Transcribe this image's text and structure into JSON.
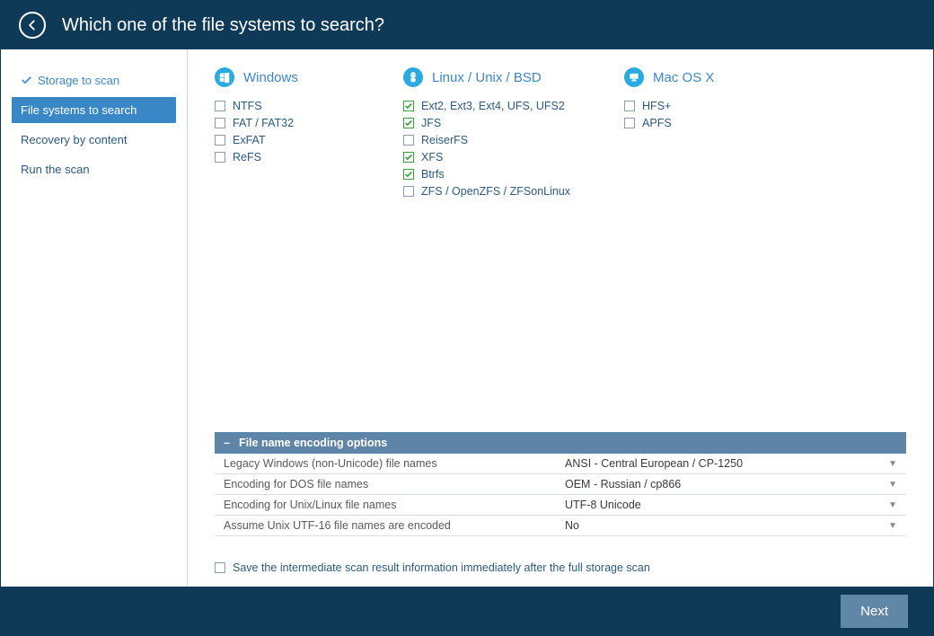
{
  "header": {
    "title": "Which one of the file systems to search?"
  },
  "sidebar": {
    "steps": [
      {
        "label": "Storage to scan",
        "state": "done"
      },
      {
        "label": "File systems to search",
        "state": "active"
      },
      {
        "label": "Recovery by content",
        "state": "pending"
      },
      {
        "label": "Run the scan",
        "state": "pending"
      }
    ]
  },
  "columns": [
    {
      "title": "Windows",
      "icon": "windows",
      "items": [
        {
          "label": "NTFS",
          "checked": false
        },
        {
          "label": "FAT / FAT32",
          "checked": false
        },
        {
          "label": "ExFAT",
          "checked": false
        },
        {
          "label": "ReFS",
          "checked": false
        }
      ]
    },
    {
      "title": "Linux / Unix / BSD",
      "icon": "linux",
      "items": [
        {
          "label": "Ext2, Ext3, Ext4, UFS, UFS2",
          "checked": true
        },
        {
          "label": "JFS",
          "checked": true
        },
        {
          "label": "ReiserFS",
          "checked": false
        },
        {
          "label": "XFS",
          "checked": true
        },
        {
          "label": "Btrfs",
          "checked": true
        },
        {
          "label": "ZFS / OpenZFS / ZFSonLinux",
          "checked": false
        }
      ]
    },
    {
      "title": "Mac OS X",
      "icon": "mac",
      "items": [
        {
          "label": "HFS+",
          "checked": false
        },
        {
          "label": "APFS",
          "checked": false
        }
      ]
    }
  ],
  "encoding": {
    "header": "File name encoding options",
    "collapse": "–",
    "rows": [
      {
        "label": "Legacy Windows (non-Unicode) file names",
        "value": "ANSI - Central European / CP-1250"
      },
      {
        "label": "Encoding for DOS file names",
        "value": "OEM - Russian / cp866"
      },
      {
        "label": "Encoding for Unix/Linux file names",
        "value": "UTF-8 Unicode"
      },
      {
        "label": "Assume Unix UTF-16 file names are encoded",
        "value": "No"
      }
    ]
  },
  "save_intermediate": {
    "label": "Save the intermediate scan result information immediately after the full storage scan",
    "checked": false
  },
  "footer": {
    "next": "Next"
  }
}
